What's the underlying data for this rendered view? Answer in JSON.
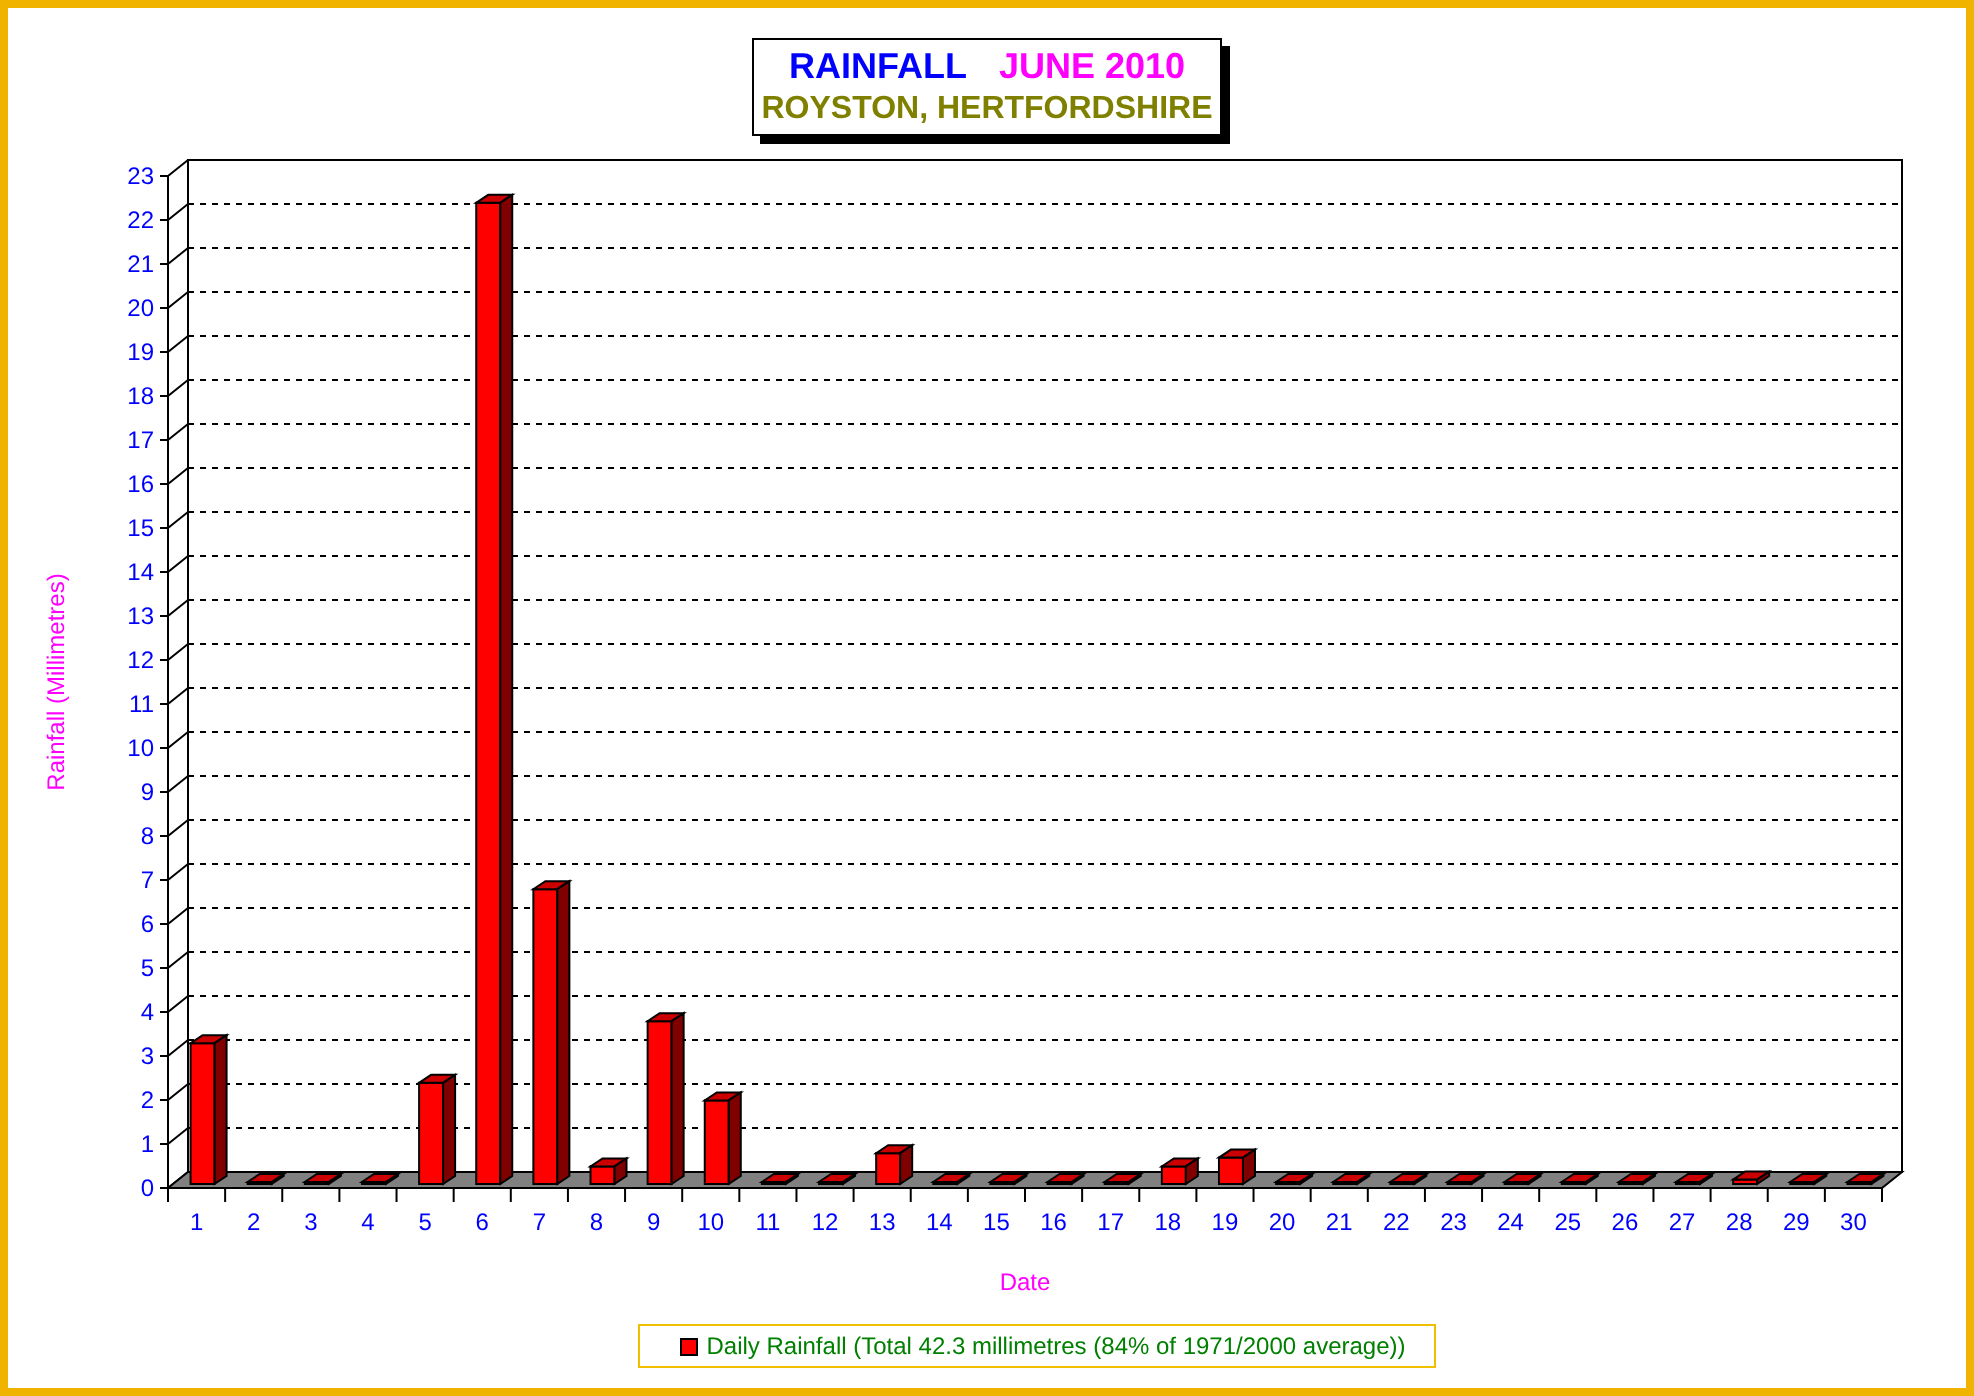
{
  "title": {
    "heading": "RAINFALL",
    "period": "JUNE 2010",
    "location": "ROYSTON, HERTFORDSHIRE"
  },
  "chart": {
    "chart_data": {
      "type": "bar",
      "xlabel": "Date",
      "ylabel": "Rainfall (Millimetres)",
      "categories": [
        "1",
        "2",
        "3",
        "4",
        "5",
        "6",
        "7",
        "8",
        "9",
        "10",
        "11",
        "12",
        "13",
        "14",
        "15",
        "16",
        "17",
        "18",
        "19",
        "20",
        "21",
        "22",
        "23",
        "24",
        "25",
        "26",
        "27",
        "28",
        "29",
        "30"
      ],
      "series": [
        {
          "name": "Daily Rainfall (Total 42.3 millimetres (84% of 1971/2000 average))",
          "color": "#ff0000",
          "values": [
            3.2,
            0,
            0,
            0,
            2.3,
            22.3,
            6.7,
            0.4,
            3.7,
            1.9,
            0,
            0,
            0.7,
            0,
            0,
            0,
            0,
            0.4,
            0.6,
            0,
            0,
            0,
            0,
            0,
            0,
            0,
            0,
            0.1,
            0,
            0
          ]
        }
      ],
      "ylim": [
        0,
        23
      ],
      "yticks": [
        0,
        1,
        2,
        3,
        4,
        5,
        6,
        7,
        8,
        9,
        10,
        11,
        12,
        13,
        14,
        15,
        16,
        17,
        18,
        19,
        20,
        21,
        22,
        23
      ]
    }
  }
}
